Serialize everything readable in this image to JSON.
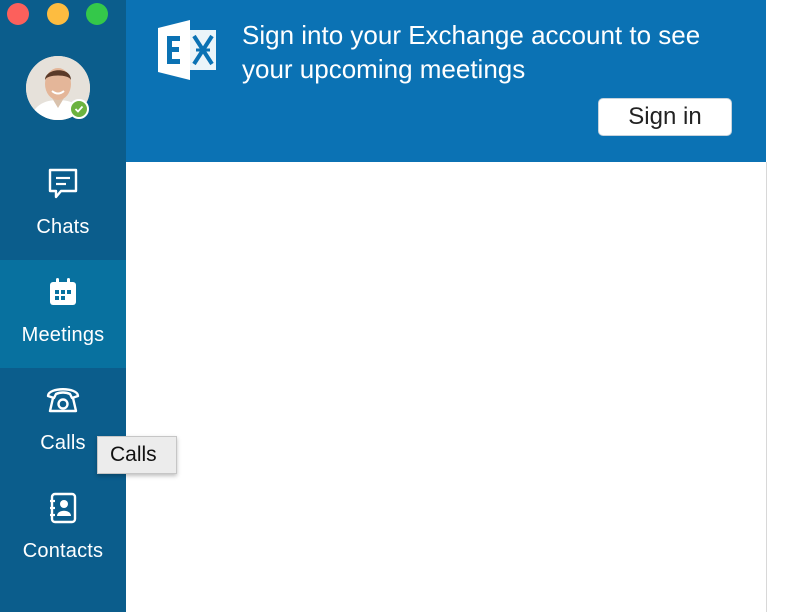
{
  "window": {
    "controls": [
      "close",
      "minimize",
      "zoom"
    ]
  },
  "sidebar": {
    "profile": {
      "status": "available"
    },
    "items": [
      {
        "label": "Chats",
        "icon": "chat-icon",
        "active": false
      },
      {
        "label": "Meetings",
        "icon": "calendar-icon",
        "active": true
      },
      {
        "label": "Calls",
        "icon": "phone-icon",
        "active": false
      },
      {
        "label": "Contacts",
        "icon": "contacts-icon",
        "active": false
      }
    ]
  },
  "banner": {
    "logo": "exchange-logo",
    "message": "Sign into your Exchange account to see your upcoming meetings",
    "sign_in_label": "Sign in"
  },
  "tooltip": {
    "text": "Calls"
  },
  "colors": {
    "sidebar": "#0b5d8c",
    "sidebar_active": "#08719f",
    "banner": "#0b72b4",
    "status_available": "#6cb33f"
  }
}
